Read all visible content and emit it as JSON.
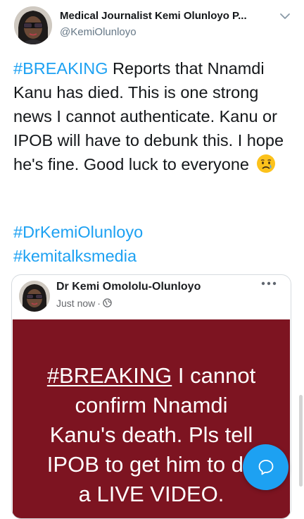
{
  "tweet": {
    "author_name": "Medical Journalist Kemi Olunloyo P...",
    "handle": "@KemiOlunloyo",
    "hashtag_breaking": "#BREAKING",
    "body_text": " Reports that Nnamdi Kanu has died. This is one strong news I cannot authenticate. Kanu or IPOB will have to debunk this. I hope he's fine. Good luck to everyone ",
    "emoji_icon": "crying-face-emoji",
    "hashtags": [
      "#DrKemiOlunloyo",
      "#kemitalksmedia"
    ]
  },
  "embedded_post": {
    "author_name": "Dr Kemi Omololu-Olunloyo",
    "timestamp": "Just now",
    "separator": "·",
    "privacy_icon": "globe-icon",
    "more_icon": "more-options-icon",
    "background_color": "#7d1421",
    "text_color": "#ffffff",
    "text_hashtag": "#BREAKING",
    "text_lines": [
      " I cannot",
      "confirm Nnamdi",
      "Kanu's death. Pls tell",
      "IPOB to get him to do",
      "a LIVE VIDEO."
    ]
  },
  "compose_button": {
    "icon": "compose-tweet-icon"
  },
  "colors": {
    "link": "#1da1f2",
    "text_primary": "#14171a",
    "text_secondary": "#657786"
  }
}
